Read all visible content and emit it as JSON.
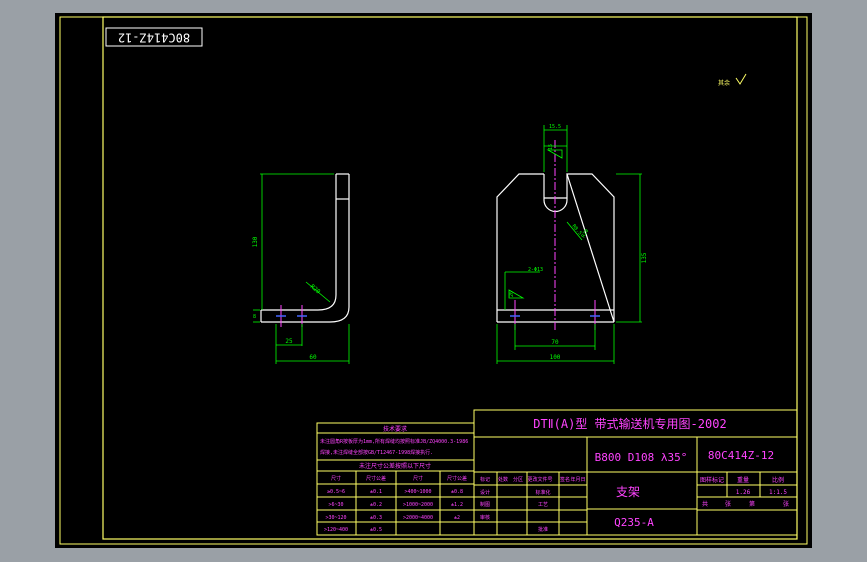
{
  "drawing_number_stamp": "80C414Z-12",
  "roughness_note": "其余",
  "dimensions": {
    "side_height": "130",
    "side_radius": "R20",
    "side_offset": "8",
    "side_25": "25",
    "side_60": "60",
    "front_top_width": "15.5",
    "front_slot_radius": "R8.5",
    "front_slot_width": "15",
    "front_chamfer": "R20",
    "front_height": "135",
    "front_holes": "2-Φ13",
    "front_hole_pos": "26",
    "front_70": "70",
    "front_width": "100"
  },
  "title_block": {
    "title_main": "DTⅡ(A)型  带式输送机专用图-2002",
    "spec": "B800 D108 λ35°",
    "drawing_number": "80C414Z-12",
    "part_name": "支架",
    "material": "Q235-A",
    "left_labels": [
      "标记",
      "处数",
      "分区",
      "更改文件号",
      "签名",
      "年月日"
    ],
    "left_roles": [
      "设计",
      "制图",
      "审核"
    ],
    "left_roles2": [
      "标准化",
      "工艺",
      "批准"
    ],
    "right_headers": [
      "图样标记",
      "重量",
      "比例"
    ],
    "weight": "1.26",
    "scale": "1:1.5",
    "sheets": [
      "共",
      "张",
      "第",
      "张"
    ]
  },
  "tech_table": {
    "header": "技术要求",
    "note_line1": "未注圆角R按板厚为1mm,所有焊缝均按照标准JB/ZQ4000.3-1986",
    "note_line2": "焊接,未注焊缝全部按GB/T12467-1998焊接执行.",
    "subheader": "未注尺寸公差按照以下尺寸",
    "cols": [
      "尺寸",
      "尺寸公差",
      "尺寸",
      "尺寸公差"
    ],
    "rows": [
      [
        "≥0.5~6",
        "±0.1",
        ">400~1000",
        "±0.8"
      ],
      [
        ">6~30",
        "±0.2",
        ">1000~2000",
        "±1.2"
      ],
      [
        ">30~120",
        "±0.3",
        ">2000~4000",
        "±2"
      ],
      [
        ">120~400",
        "±0.5",
        "",
        ""
      ]
    ]
  }
}
